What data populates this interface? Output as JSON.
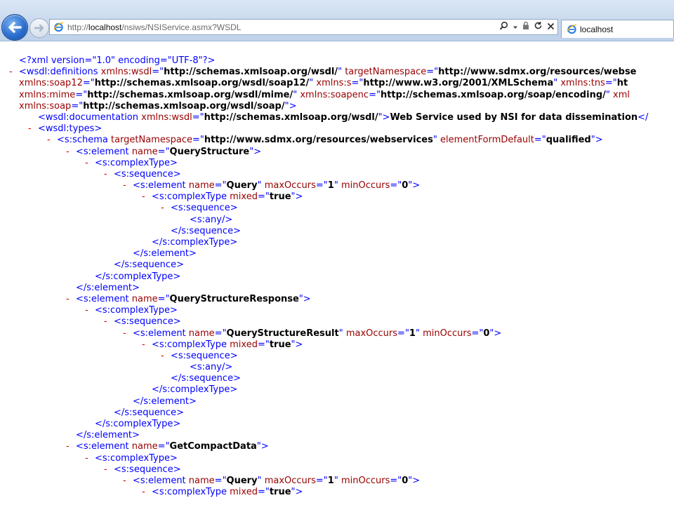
{
  "browser": {
    "url_prefix": "http://",
    "url_host": "localhost",
    "url_path": "/nsiws/NSIService.asmx?WSDL",
    "tab_title": "localhost",
    "icons": [
      "back-arrow-icon",
      "forward-arrow-icon",
      "ie-page-icon",
      "search-icon",
      "dropdown-icon",
      "lock-icon",
      "refresh-icon",
      "stop-icon"
    ]
  },
  "xml": {
    "declaration": "<?xml version=\"1.0\" encoding=\"UTF-8\"?>",
    "ns": {
      "wsdl": "http://schemas.xmlsoap.org/wsdl/",
      "target": "http://www.sdmx.org/resources/webse",
      "soap12": "http://schemas.xmlsoap.org/wsdl/soap12/",
      "s": "http://www.w3.org/2001/XMLSchema",
      "tns_start": "ht",
      "mime": "http://schemas.xmlsoap.org/wsdl/mime/",
      "soapenc": "http://schemas.xmlsoap.org/soap/encoding/",
      "soap": "http://schemas.xmlsoap.org/wsdl/soap/"
    },
    "documentation_text": "Web Service used by NSI for data dissemination",
    "schema_target": "http://www.sdmx.org/resources/webservices",
    "element_form_default": "qualified",
    "elements": {
      "e1": "QueryStructure",
      "e1_child": "Query",
      "e2": "QueryStructureResponse",
      "e2_child": "QueryStructureResult",
      "e3": "GetCompactData",
      "e3_child": "Query"
    },
    "max_occurs": "1",
    "min_occurs": "0",
    "mixed": "true"
  }
}
